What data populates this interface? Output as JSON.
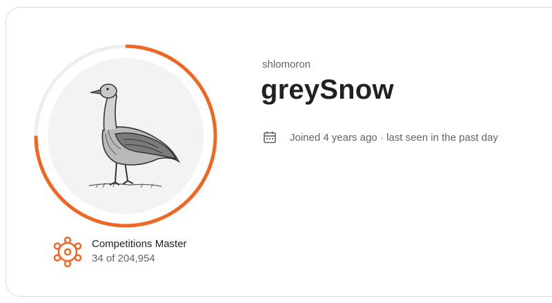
{
  "profile": {
    "username": "shlomoron",
    "display_name": "greySnow",
    "joined_text": "Joined 4 years ago · last seen in the past day",
    "avatar_icon": "goose-illustration",
    "progress_ring_fraction": 0.75
  },
  "tier": {
    "icon": "competitions-tier-icon",
    "title": "Competitions Master",
    "rank_text": "34 of 204,954"
  },
  "icons": {
    "calendar": "calendar-icon"
  },
  "colors": {
    "accent": "#f06623",
    "ring_track": "#eeeeee",
    "avatar_bg": "#f3f3f3",
    "text_primary": "#202124",
    "text_secondary": "#5f6368"
  }
}
